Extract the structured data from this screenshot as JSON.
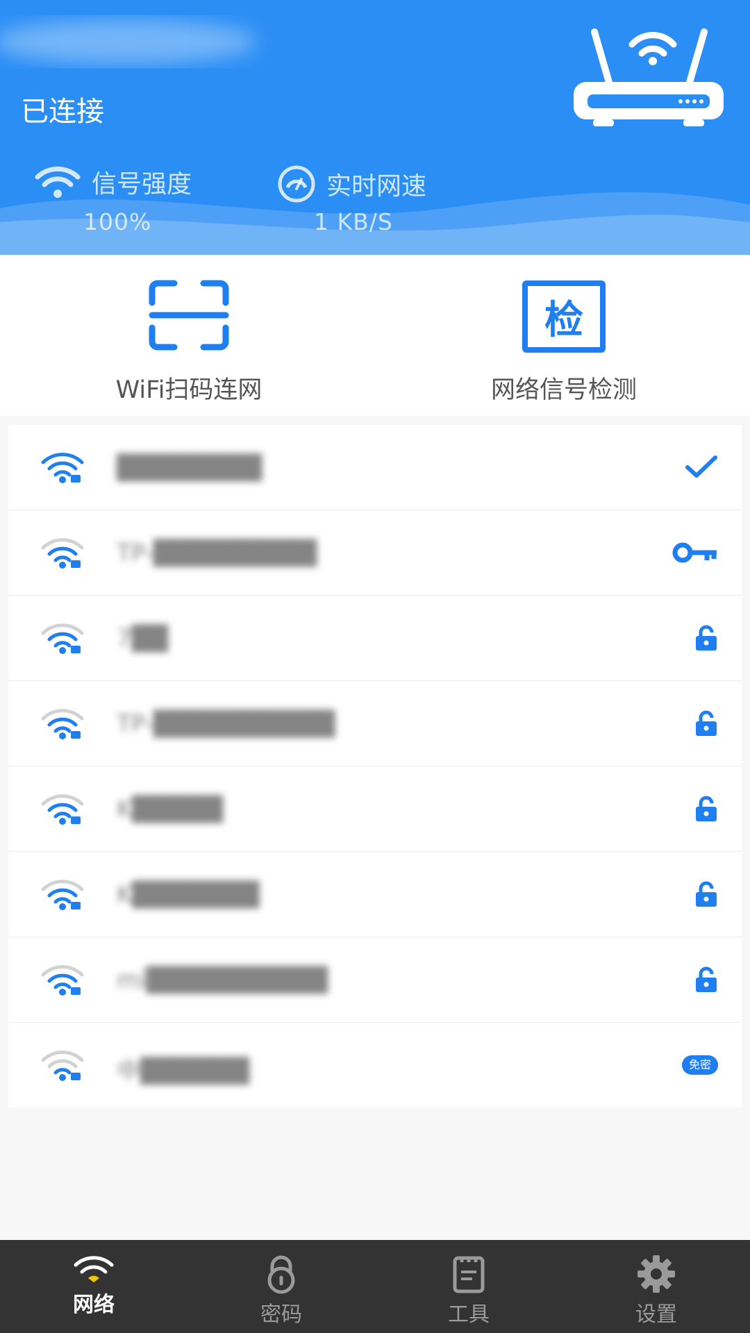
{
  "header": {
    "status": "已连接",
    "signal_label": "信号强度",
    "signal_value": "100%",
    "speed_label": "实时网速",
    "speed_value": "1 KB/S"
  },
  "actions": [
    {
      "label": "WiFi扫码连网",
      "icon": "scan-icon"
    },
    {
      "label": "网络信号检测",
      "icon": "detect-icon",
      "glyph": "检"
    }
  ],
  "wifi_list": [
    {
      "ssid": "████████",
      "signal": 1.0,
      "end_icon": "check-icon"
    },
    {
      "ssid": "TP-█████████",
      "signal": 0.75,
      "end_icon": "key-icon"
    },
    {
      "ssid": "7██",
      "signal": 0.75,
      "end_icon": "lock-icon"
    },
    {
      "ssid": "TP-██████████",
      "signal": 0.5,
      "end_icon": "lock-icon"
    },
    {
      "ssid": "K█████",
      "signal": 0.5,
      "end_icon": "lock-icon"
    },
    {
      "ssid": "K███████",
      "signal": 0.5,
      "end_icon": "lock-icon"
    },
    {
      "ssid": "mi██████████",
      "signal": 0.5,
      "end_icon": "lock-icon"
    },
    {
      "ssid": "中██████",
      "signal": 0.25,
      "end_icon": "free-badge",
      "badge": "免密"
    }
  ],
  "nav": [
    {
      "label": "网络",
      "icon": "wifi-icon",
      "active": true
    },
    {
      "label": "密码",
      "icon": "lock-icon",
      "active": false
    },
    {
      "label": "工具",
      "icon": "clipboard-icon",
      "active": false
    },
    {
      "label": "设置",
      "icon": "gear-icon",
      "active": false
    }
  ],
  "colors": {
    "accent": "#2b8ef5",
    "icon_blue": "#1f7ff0",
    "nav_bg": "#333333",
    "wifi_active_yellow": "#f5c400"
  }
}
